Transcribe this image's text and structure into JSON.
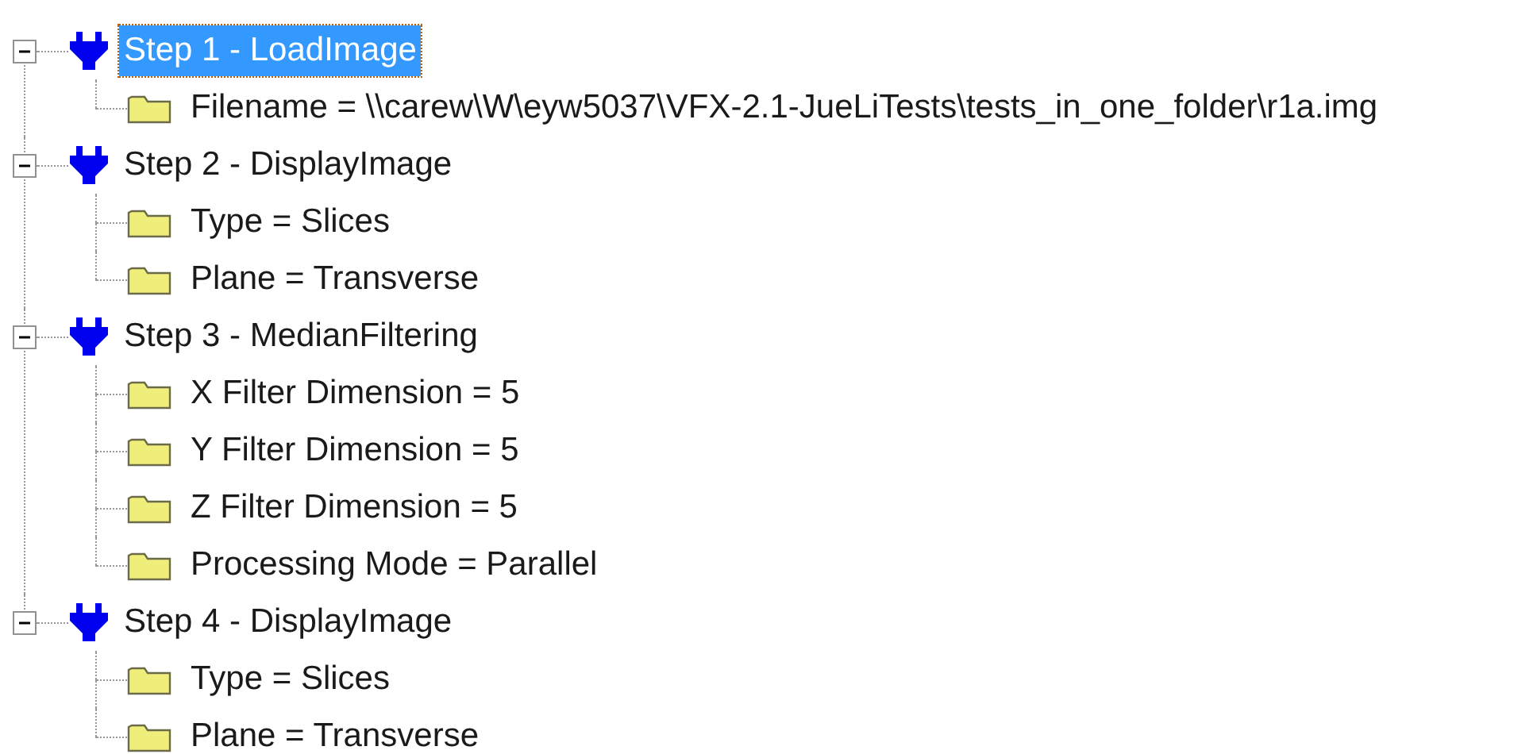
{
  "tree": [
    {
      "label": "Step 1 - LoadImage",
      "selected": true,
      "expanded": true,
      "children": [
        {
          "label": "Filename = \\\\carew\\W\\eyw5037\\VFX-2.1-JueLiTests\\tests_in_one_folder\\r1a.img"
        }
      ]
    },
    {
      "label": "Step 2 - DisplayImage",
      "selected": false,
      "expanded": true,
      "children": [
        {
          "label": "Type = Slices"
        },
        {
          "label": "Plane = Transverse"
        }
      ]
    },
    {
      "label": "Step 3 - MedianFiltering",
      "selected": false,
      "expanded": true,
      "children": [
        {
          "label": "X Filter Dimension = 5"
        },
        {
          "label": "Y Filter Dimension = 5"
        },
        {
          "label": "Z Filter Dimension = 5"
        },
        {
          "label": "Processing Mode = Parallel"
        }
      ]
    },
    {
      "label": "Step 4 - DisplayImage",
      "selected": false,
      "expanded": true,
      "children": [
        {
          "label": "Type = Slices"
        },
        {
          "label": "Plane = Transverse"
        }
      ]
    }
  ]
}
